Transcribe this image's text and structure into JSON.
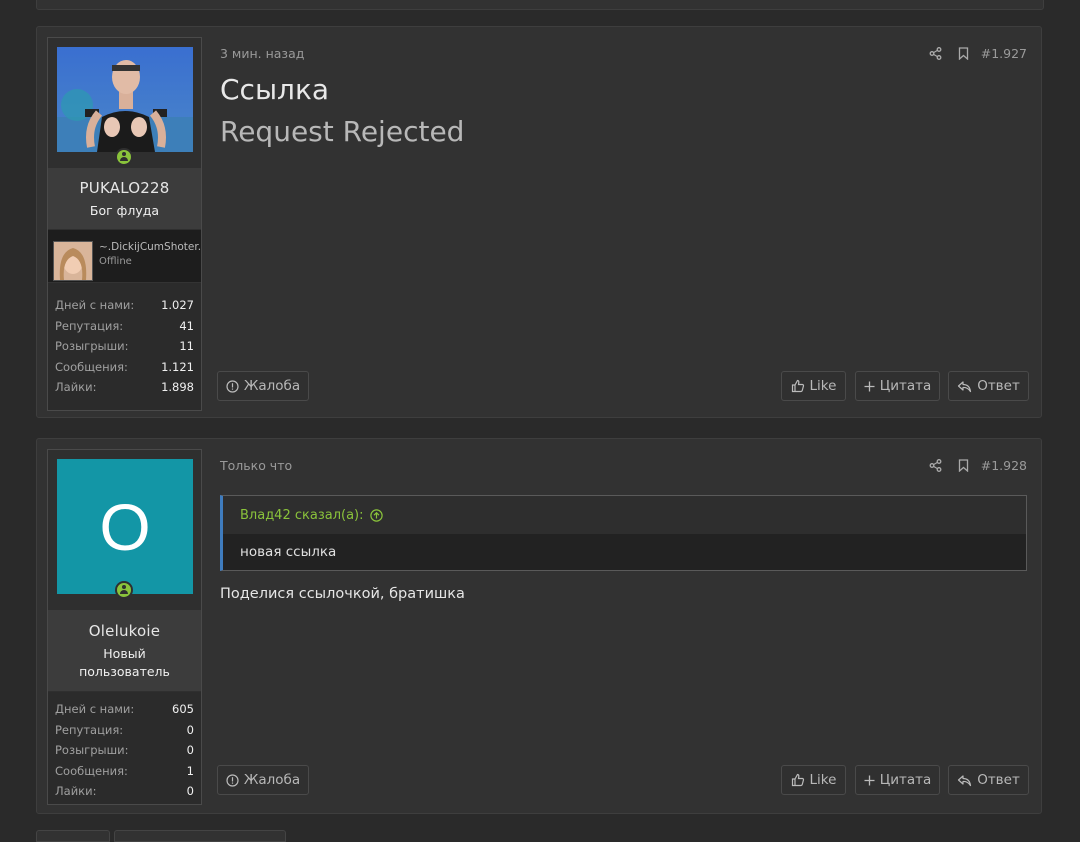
{
  "posts": [
    {
      "username": "PUKALO228",
      "user_title": "Бог флуда",
      "friend": {
        "name": "~.DickijCumShoter.~",
        "status": "Offline"
      },
      "stats": [
        {
          "label": "Дней с нами:",
          "value": "1.027"
        },
        {
          "label": "Репутация:",
          "value": "41"
        },
        {
          "label": "Розыгрыши:",
          "value": "11"
        },
        {
          "label": "Сообщения:",
          "value": "1.121"
        },
        {
          "label": "Лайки:",
          "value": "1.898"
        }
      ],
      "time": "3 мин. назад",
      "post_number": "#1.927",
      "title_line1": "Ссылка",
      "title_line2": "Request Rejected",
      "report_label": "Жалоба",
      "like_label": "Like",
      "quote_label": "Цитата",
      "reply_label": "Ответ"
    },
    {
      "username": "Olelukoie",
      "user_title": "Новый пользователь",
      "avatar_letter": "O",
      "avatar_color": "#1396a6",
      "stats": [
        {
          "label": "Дней с нами:",
          "value": "605"
        },
        {
          "label": "Репутация:",
          "value": "0"
        },
        {
          "label": "Розыгрыши:",
          "value": "0"
        },
        {
          "label": "Сообщения:",
          "value": "1"
        },
        {
          "label": "Лайки:",
          "value": "0"
        }
      ],
      "time": "Только что",
      "post_number": "#1.928",
      "quote": {
        "author": "Влад42 сказал(а):",
        "text": "новая ссылка"
      },
      "text": "Поделися ссылочкой, братишка",
      "report_label": "Жалоба",
      "like_label": "Like",
      "quote_label": "Цитата",
      "reply_label": "Ответ"
    }
  ],
  "colors": {
    "online": "#8ac33b",
    "quote_border": "#3f7cbe",
    "quote_author": "#8ac33b"
  }
}
